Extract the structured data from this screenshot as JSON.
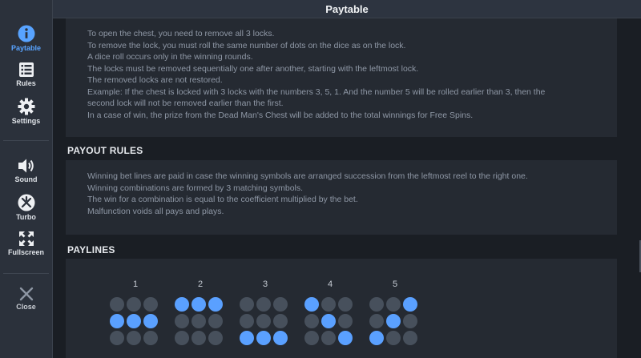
{
  "topbar": {
    "title": "Paytable"
  },
  "sidebar": {
    "paytable_label": "Paytable",
    "rules_label": "Rules",
    "settings_label": "Settings",
    "sound_label": "Sound",
    "turbo_label": "Turbo",
    "fullscreen_label": "Fullscreen",
    "close_label": "Close"
  },
  "chest_rules": {
    "lines": [
      "To open the chest, you need to remove all 3 locks.",
      "To remove the lock, you must roll the same number of dots on the dice as on the lock.",
      "A dice roll occurs only in the winning rounds.",
      "The locks must be removed sequentially one after another, starting with the leftmost lock.",
      "The removed locks are not restored.",
      "Example: If the chest is locked with 3 locks with the numbers 3, 5, 1. And the number 5 will be rolled earlier than 3, then the",
      "second lock will not be removed earlier than the first.",
      "In a case of win, the prize from the Dead Man's Chest will be added to the total winnings for Free Spins."
    ]
  },
  "payout_rules": {
    "title": "PAYOUT RULES",
    "lines": [
      "Winning bet lines are paid in case the winning symbols are arranged succession from the leftmost reel to the right one.",
      "Winning combinations are formed by 3 matching symbols.",
      "The win for a combination is equal to the coefficient multiplied by the bet.",
      "Malfunction voids all pays and plays."
    ]
  },
  "paylines": {
    "title": "PAYLINES",
    "colors": {
      "active": "#5aa0ff",
      "inactive": "#47505c"
    },
    "items": [
      {
        "number": "1",
        "pattern": [
          [
            0,
            0,
            0
          ],
          [
            1,
            1,
            1
          ],
          [
            0,
            0,
            0
          ]
        ]
      },
      {
        "number": "2",
        "pattern": [
          [
            1,
            1,
            1
          ],
          [
            0,
            0,
            0
          ],
          [
            0,
            0,
            0
          ]
        ]
      },
      {
        "number": "3",
        "pattern": [
          [
            0,
            0,
            0
          ],
          [
            0,
            0,
            0
          ],
          [
            1,
            1,
            1
          ]
        ]
      },
      {
        "number": "4",
        "pattern": [
          [
            1,
            0,
            0
          ],
          [
            0,
            1,
            0
          ],
          [
            0,
            0,
            1
          ]
        ]
      },
      {
        "number": "5",
        "pattern": [
          [
            0,
            0,
            1
          ],
          [
            0,
            1,
            0
          ],
          [
            1,
            0,
            0
          ]
        ]
      }
    ]
  }
}
